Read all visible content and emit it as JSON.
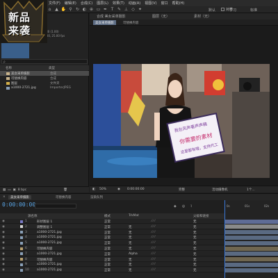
{
  "menu": [
    "文件(F)",
    "编辑(E)",
    "合成(C)",
    "图层(L)",
    "效果(T)",
    "动画(A)",
    "视图(V)",
    "窗口",
    "帮助(H)"
  ],
  "toolbar": {
    "snap_label": "对齐",
    "workspace_items": [
      "默认",
      "学习",
      "标准"
    ]
  },
  "logo": {
    "line1": "新品",
    "line2": "来袭"
  },
  "project": {
    "info_lines": [
      "1920 x 1080 (1.00)",
      "Δ 0:00:10:00, 25.00 fps"
    ],
    "search_placeholder": "ρ",
    "col_name": "名称",
    "col_type": "类型",
    "items": [
      {
        "name": "美女采单摄影",
        "type": "合成"
      },
      {
        "name": "可替换内容",
        "type": "合成"
      },
      {
        "name": "图层",
        "type": "文件夹"
      },
      {
        "name": "a1000-2721.jpg",
        "type": "ImporterJPEG"
      }
    ],
    "footer": "8 bpc"
  },
  "comp": {
    "tab_main": "合成 美女采单摄影",
    "tab_layer": "图层（无）",
    "tab_footage": "素材（无）",
    "crumb_active": "美女采单摄影",
    "crumb_next": "可替换内容",
    "sign_lines": [
      "我在风声看声声稿",
      "你需要的素材",
      "这里都有哦，支持代工"
    ],
    "footer": {
      "zoom": "50%",
      "timecode": "0:00:00:00",
      "quality": "完整",
      "camera": "活动摄像机",
      "views": "1个..."
    }
  },
  "timeline": {
    "tab_render": "渲染队列",
    "tab_comp": "美女采单摄影",
    "tab_replace": "可替换内容",
    "timecode": "0:00:00:00",
    "ruler_marks": [
      "0s",
      "01s",
      "02s"
    ],
    "headers": {
      "name": "源名称",
      "mode": "模式",
      "trkmat": "TrkMat",
      "parent": "父级和链接"
    },
    "layers": [
      {
        "index": "1",
        "name": "形状图层 1",
        "mode": "正常",
        "trkmat": "",
        "parent": "无",
        "color": "#7a7ac8"
      },
      {
        "index": "2",
        "name": "调整图层 1",
        "mode": "正常",
        "trkmat": "无",
        "parent": "无",
        "color": "#d8d8d8"
      },
      {
        "index": "3",
        "name": "a1000-2721.jpg",
        "mode": "正常",
        "trkmat": "无",
        "parent": "无",
        "color": "#8aa0b8"
      },
      {
        "index": "4",
        "name": "a1000-2721.jpg",
        "mode": "正常",
        "trkmat": "无",
        "parent": "无",
        "color": "#8aa0b8"
      },
      {
        "index": "5",
        "name": "a1000-2721.jpg",
        "mode": "正常",
        "trkmat": "无",
        "parent": "无",
        "color": "#8aa0b8"
      },
      {
        "index": "6",
        "name": "可替换内容",
        "mode": "正常",
        "trkmat": "无",
        "parent": "无",
        "color": "#b8a070"
      },
      {
        "index": "7",
        "name": "a1000-2721.jpg",
        "mode": "正常",
        "trkmat": "Alpha",
        "parent": "无",
        "color": "#8aa0b8"
      },
      {
        "index": "8",
        "name": "可替换内容",
        "mode": "正常",
        "trkmat": "无",
        "parent": "无",
        "color": "#b8a070"
      },
      {
        "index": "9",
        "name": "a1000-2721.jpg",
        "mode": "正常",
        "trkmat": "无",
        "parent": "无",
        "color": "#8aa0b8"
      },
      {
        "index": "10",
        "name": "a1000-2721.jpg",
        "mode": "正常",
        "trkmat": "无",
        "parent": "无",
        "color": "#8aa0b8"
      }
    ]
  }
}
